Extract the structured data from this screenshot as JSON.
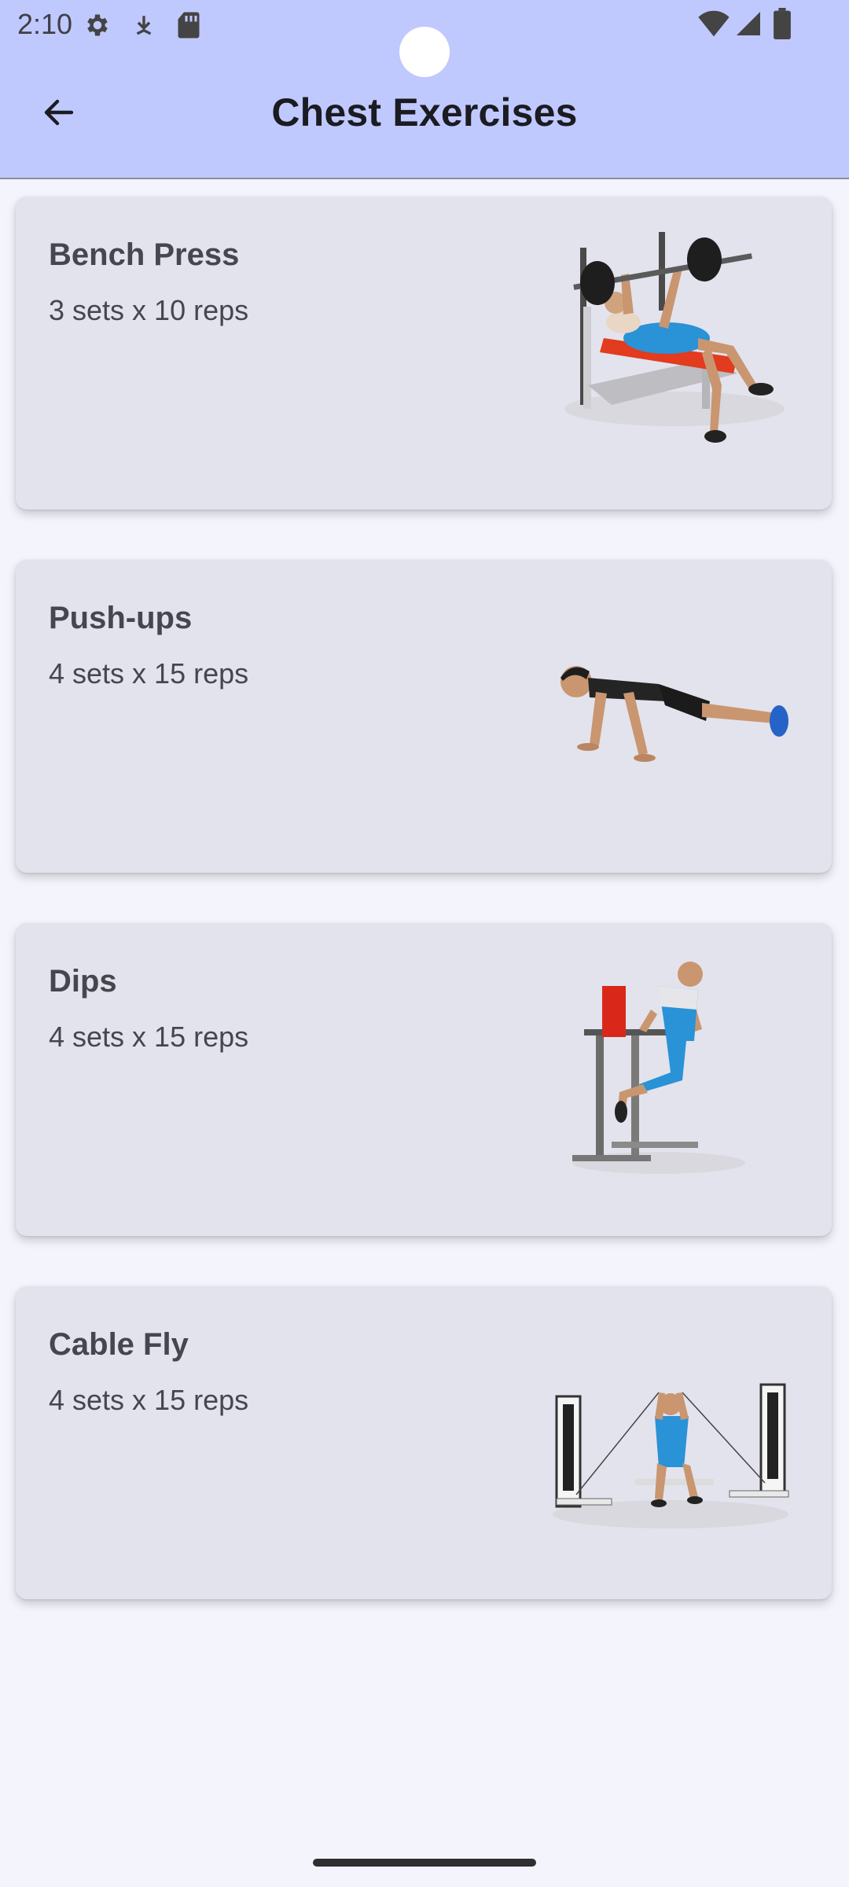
{
  "status_bar": {
    "time": "2:10",
    "icons": [
      "settings-icon",
      "download-icon",
      "sd-card-icon",
      "wifi-icon",
      "signal-icon",
      "battery-icon"
    ]
  },
  "app_bar": {
    "title": "Chest Exercises",
    "back_icon": "arrow-back-icon"
  },
  "colors": {
    "app_bar": "#c0c9fd",
    "background": "#f4f5fc",
    "card": "#e3e3ed",
    "text": "#46464f",
    "title": "#1b1b22"
  },
  "exercises": [
    {
      "name": "Bench Press",
      "detail": "3 sets x 10 reps",
      "image": "bench-press-illustration"
    },
    {
      "name": "Push-ups",
      "detail": "4 sets x 15 reps",
      "image": "push-ups-illustration"
    },
    {
      "name": "Dips",
      "detail": "4 sets x 15 reps",
      "image": "dips-illustration"
    },
    {
      "name": "Cable Fly",
      "detail": "4 sets x 15 reps",
      "image": "cable-fly-illustration"
    }
  ]
}
